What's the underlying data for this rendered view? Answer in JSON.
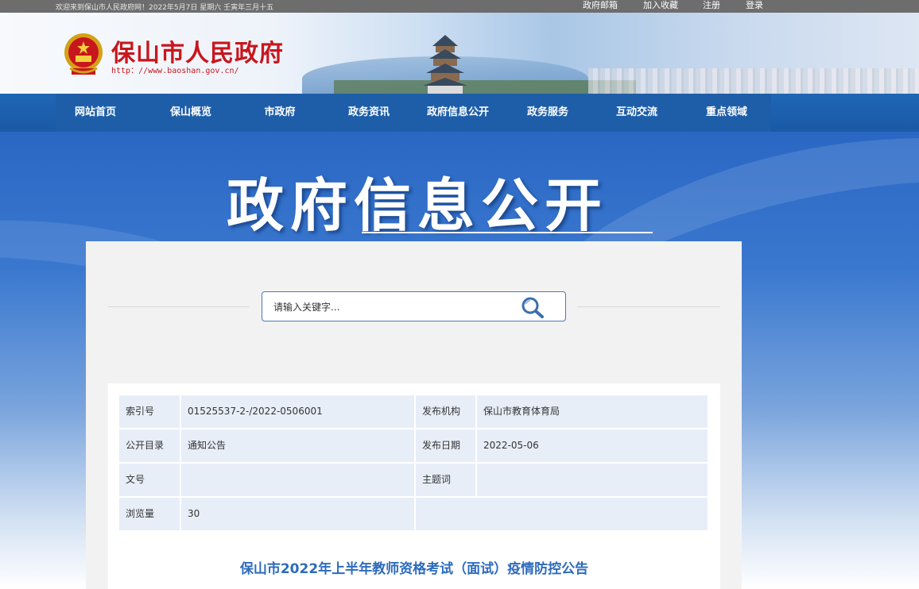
{
  "topbar": {
    "welcome": "欢迎来到保山市人民政府网！2022年5月7日  星期六  壬寅年三月十五",
    "links": [
      "政府邮箱",
      "加入收藏",
      "注册",
      "登录"
    ]
  },
  "banner": {
    "title": "保山市人民政府",
    "url": "http：//www.baoshan.gov.cn/"
  },
  "nav": {
    "items": [
      "网站首页",
      "保山概览",
      "市政府",
      "政务资讯",
      "政府信息公开",
      "政务服务",
      "互动交流",
      "重点领域"
    ]
  },
  "hero": {
    "title": "政府信息公开"
  },
  "search": {
    "placeholder": "请输入关键字..."
  },
  "meta": {
    "rows": [
      {
        "label1": "索引号",
        "value1": "01525537-2-/2022-0506001",
        "label2": "发布机构",
        "value2": "保山市教育体育局"
      },
      {
        "label1": "公开目录",
        "value1": "通知公告",
        "label2": "发布日期",
        "value2": "2022-05-06"
      },
      {
        "label1": "文号",
        "value1": "",
        "label2": "主题词",
        "value2": ""
      },
      {
        "label1": "浏览量",
        "value1": "30"
      }
    ]
  },
  "article": {
    "title": "保山市2022年上半年教师资格考试（面试）疫情防控公告"
  },
  "colors": {
    "brand_red": "#c8161d",
    "nav_blue": "#1e5ea9",
    "title_blue": "#2d6bbd",
    "meta_bg": "#e8eef8"
  }
}
